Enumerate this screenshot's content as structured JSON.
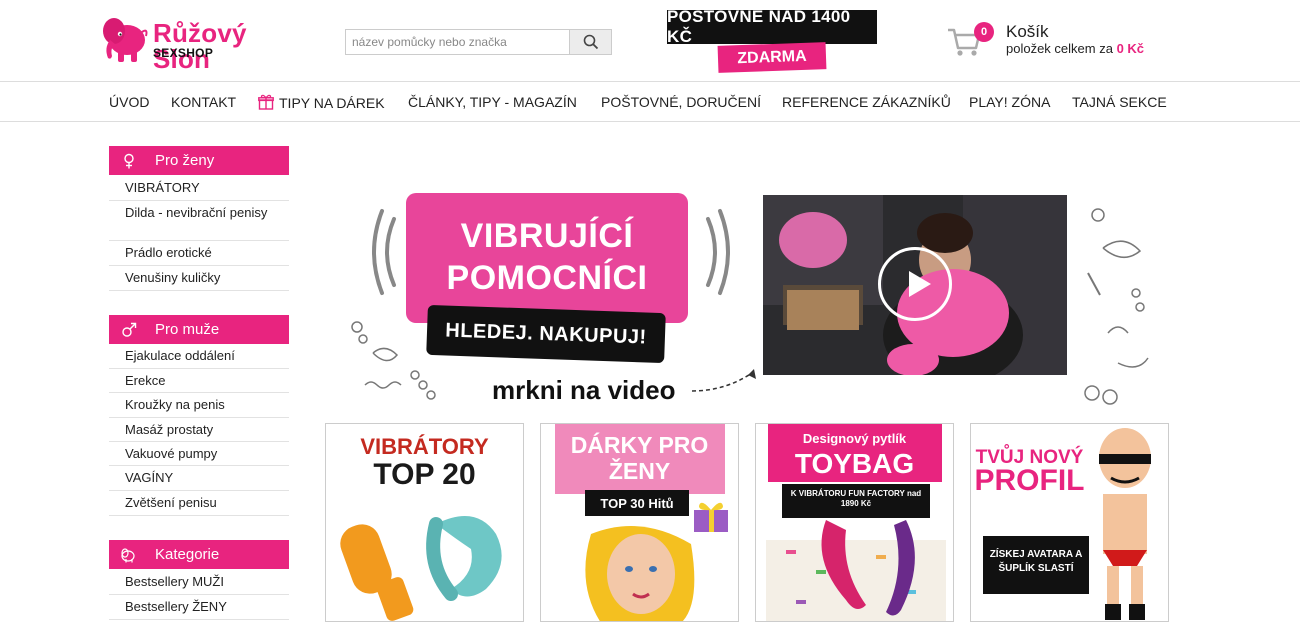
{
  "header": {
    "logo_title": "Růžový Slon",
    "logo_sub": "SEXSHOP",
    "search_placeholder": "název pomůcky nebo značka",
    "shipping_top": "POŠTOVNÉ NAD 1400 KČ",
    "shipping_bottom": "ZDARMA",
    "cart": {
      "count": "0",
      "title": "Košík",
      "info": "položek celkem za",
      "amount": "0 Kč"
    }
  },
  "nav": [
    {
      "label": "ÚVOD",
      "icon": null
    },
    {
      "label": "KONTAKT",
      "icon": null
    },
    {
      "label": "TIPY NA DÁREK",
      "icon": "gift-icon"
    },
    {
      "label": "ČLÁNKY, TIPY - MAGAZÍN",
      "icon": null
    },
    {
      "label": "POŠTOVNÉ, DORUČENÍ",
      "icon": null
    },
    {
      "label": "REFERENCE ZÁKAZNÍKŮ",
      "icon": null
    },
    {
      "label": "PLAY! ZÓNA",
      "icon": null
    },
    {
      "label": "TAJNÁ SEKCE",
      "icon": null
    }
  ],
  "sidebar": {
    "women": {
      "title": "Pro ženy",
      "icon": "female-symbol-icon",
      "items": [
        "VIBRÁTORY",
        "Dilda - nevibrační penisy",
        "Prádlo erotické",
        "Venušiny kuličky"
      ]
    },
    "men": {
      "title": "Pro muže",
      "icon": "male-symbol-icon",
      "items": [
        "Ejakulace oddálení",
        "Erekce",
        "Kroužky na penis",
        "Masáž prostaty",
        "Vakuové pumpy",
        "VAGÍNY",
        "Zvětšení penisu"
      ]
    },
    "categories": {
      "title": "Kategorie",
      "icon": "category-icon",
      "items": [
        "Bestsellery MUŽI",
        "Bestsellery ŽENY"
      ]
    }
  },
  "hero": {
    "line1": "VIBRUJÍCÍ",
    "line2": "POMOCNÍCI",
    "tagline": "HLEDEJ. NAKUPUJ!",
    "video_cta": "mrkni na video"
  },
  "tiles": [
    {
      "line1": "VIBRÁTORY",
      "line2": "TOP 20"
    },
    {
      "line1": "DÁRKY PRO",
      "line2": "ŽENY",
      "badge": "TOP 30 Hitů"
    },
    {
      "line1": "Designový pytlík",
      "line2": "TOYBAG",
      "sub": "K VIBRÁTORU FUN FACTORY nad 1890 Kč"
    },
    {
      "line1": "TVŮJ NOVÝ",
      "line2": "PROFIL",
      "badge": "ZÍSKEJ AVATARA A ŠUPLÍK SLASTÍ"
    }
  ],
  "colors": {
    "brand_pink": "#e8247f",
    "dark": "#111111"
  }
}
